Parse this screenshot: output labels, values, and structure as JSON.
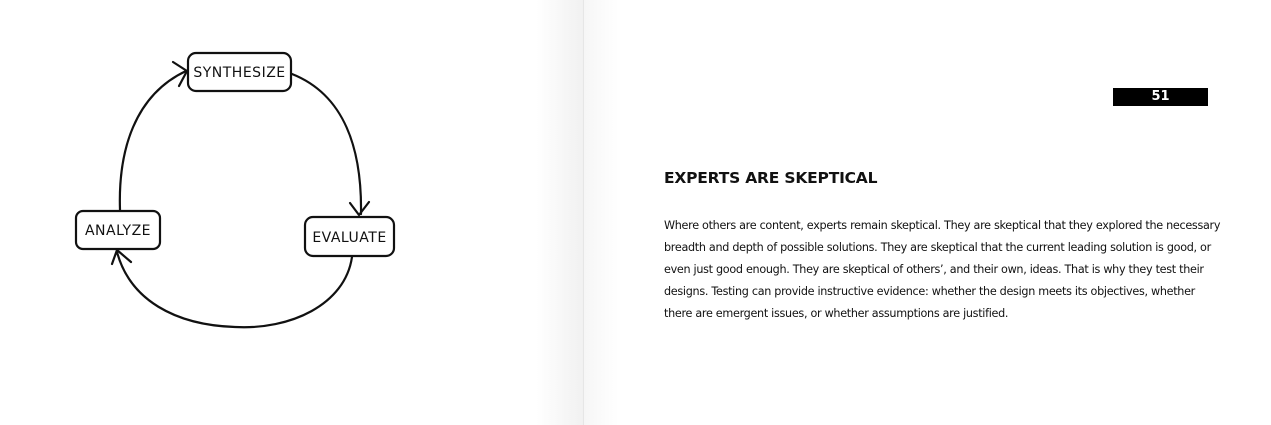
{
  "diagram": {
    "nodes": {
      "synthesize": "SYNTHESIZE",
      "evaluate": "EVALUATE",
      "analyze": "ANALYZE"
    }
  },
  "page": {
    "number": "51",
    "heading": "EXPERTS ARE SKEPTICAL",
    "body": "Where others are content, experts remain skeptical. They are skeptical that they explored the necessary breadth and depth of possible solutions. They are skeptical that the current leading solution is good, or even just good enough. They are skeptical of others’, and their own, ideas. That is why they test their designs. Testing can provide instructive evidence: whether the design meets its objectives, whether there are emergent issues, or whether assumptions are justified."
  },
  "colors": {
    "ink": "#111111",
    "page_number_bg": "#000000",
    "page_number_fg": "#ffffff"
  }
}
